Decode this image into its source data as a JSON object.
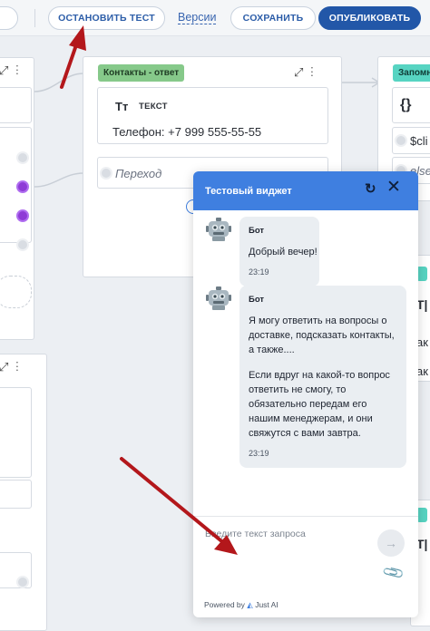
{
  "toolbar": {
    "edge_button": "",
    "stop_test": "ОСТАНОВИТЬ ТЕСТ",
    "versions": "Версии",
    "save": "СОХРАНИТЬ",
    "publish": "ОПУБЛИКОВАТЬ"
  },
  "canvas": {
    "contacts_card": {
      "tag": "Контакты - ответ",
      "text_block_label": "ТЕКСТ",
      "text_block_icon": "Tт",
      "phone": "Телефон: +7 999 555-55-55",
      "button_placeholder": "Переход"
    },
    "right_card": {
      "tag": "Запомн",
      "brace": "{}",
      "var1": "$cli",
      "var2": "else"
    },
    "right_partials": [
      "Т|",
      "ак",
      "ак",
      "Т|"
    ]
  },
  "widget": {
    "title": "Тестовый виджет",
    "messages": [
      {
        "sender": "Бот",
        "lines": [
          "Добрый вечер!"
        ],
        "time": "23:19"
      },
      {
        "sender": "Бот",
        "paragraphs": [
          [
            "Я могу ответить на вопросы о",
            "доставке, подсказать контакты,",
            "а также...."
          ],
          [
            "Если вдруг на какой-то вопрос",
            "ответить не смогу, то",
            "обязательно передам его",
            "нашим менеджерам, и они",
            "свяжутся с вами завтра."
          ]
        ],
        "time": "23:19"
      }
    ],
    "input_placeholder": "Введите текст запроса",
    "powered_by": "Powered by",
    "brand": "Just AI"
  },
  "colors": {
    "header_blue": "#3f7fe0",
    "publish_blue": "#2257a8",
    "tag_green": "#86c98a",
    "tag_teal": "#57d4c2",
    "annotation_red": "#b3171b"
  }
}
